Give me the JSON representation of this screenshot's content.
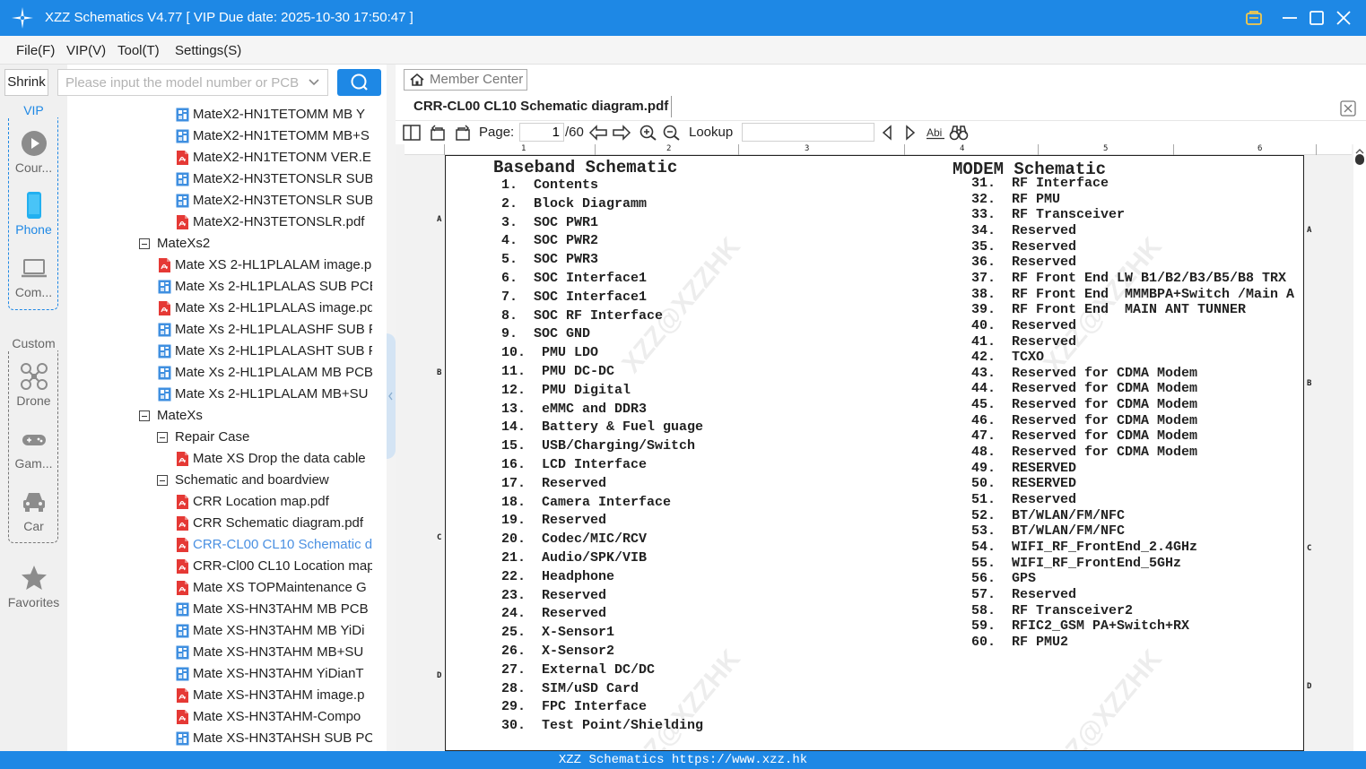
{
  "app": {
    "title": "XZZ Schematics V4.77 [ VIP Due date: 2025-10-30 17:50:47 ]",
    "accent_color": "#1e88e5"
  },
  "window_controls": [
    "vip-badge-icon",
    "minimize-icon",
    "maximize-icon",
    "close-icon"
  ],
  "menu": [
    "File(F)",
    "VIP(V)",
    "Tool(T)",
    "Settings(S)"
  ],
  "sidebar": {
    "shrink_label": "Shrink",
    "vip_label": "VIP",
    "custom_label": "Custom",
    "items": [
      {
        "label": "Cour...",
        "icon": "play-circle-icon",
        "active": false
      },
      {
        "label": "Phone",
        "icon": "phone-icon",
        "active": true
      },
      {
        "label": "Com...",
        "icon": "laptop-icon",
        "active": false
      },
      {
        "label": "Drone",
        "icon": "drone-icon",
        "active": false
      },
      {
        "label": "Gam...",
        "icon": "gamepad-icon",
        "active": false
      },
      {
        "label": "Car",
        "icon": "car-icon",
        "active": false
      },
      {
        "label": "Favorites",
        "icon": "star-icon",
        "active": false
      }
    ]
  },
  "search": {
    "placeholder": "Please input the model number or PCB",
    "value": ""
  },
  "tree": [
    {
      "label": "MateX2-HN1TETOMM MB Y",
      "type": "pcb",
      "depth": 3
    },
    {
      "label": "MateX2-HN1TETOMM MB+S",
      "type": "pcb",
      "depth": 3
    },
    {
      "label": "MateX2-HN1TETONM VER.E",
      "type": "pdf",
      "depth": 3
    },
    {
      "label": "MateX2-HN3TETONSLR SUB",
      "type": "pcb",
      "depth": 3
    },
    {
      "label": "MateX2-HN3TETONSLR SUB",
      "type": "pcb",
      "depth": 3
    },
    {
      "label": "MateX2-HN3TETONSLR.pdf",
      "type": "pdf",
      "depth": 3
    },
    {
      "label": "MateXs2",
      "type": "folder",
      "depth": 1
    },
    {
      "label": "Mate XS 2-HL1PLALAM image.p",
      "type": "pdf",
      "depth": 2
    },
    {
      "label": "Mate Xs 2-HL1PLALAS SUB PCB I",
      "type": "pcb",
      "depth": 2
    },
    {
      "label": "Mate Xs 2-HL1PLALAS image.pdf",
      "type": "pdf",
      "depth": 2
    },
    {
      "label": "Mate Xs 2-HL1PLALASHF SUB PC",
      "type": "pcb",
      "depth": 2
    },
    {
      "label": "Mate Xs 2-HL1PLALASHT SUB PC",
      "type": "pcb",
      "depth": 2
    },
    {
      "label": "Mate Xs 2-HL1PLALAM MB PCB",
      "type": "pcb",
      "depth": 2
    },
    {
      "label": "Mate Xs 2-HL1PLALAM MB+SU",
      "type": "pcb",
      "depth": 2
    },
    {
      "label": "MateXs",
      "type": "folder",
      "depth": 1
    },
    {
      "label": "Repair Case",
      "type": "folder",
      "depth": 2
    },
    {
      "label": "Mate XS Drop the data cable",
      "type": "pdf",
      "depth": 3
    },
    {
      "label": "Schematic and boardview",
      "type": "folder",
      "depth": 2
    },
    {
      "label": "CRR Location map.pdf",
      "type": "pdf",
      "depth": 3
    },
    {
      "label": "CRR Schematic diagram.pdf",
      "type": "pdf",
      "depth": 3
    },
    {
      "label": "CRR-CL00 CL10 Schematic di",
      "type": "pdf",
      "depth": 3,
      "selected": true
    },
    {
      "label": "CRR-Cl00 CL10 Location map",
      "type": "pdf",
      "depth": 3
    },
    {
      "label": "Mate XS TOPMaintenance G",
      "type": "pdf",
      "depth": 3
    },
    {
      "label": "Mate XS-HN3TAHM MB PCB",
      "type": "pcb",
      "depth": 3
    },
    {
      "label": "Mate XS-HN3TAHM MB YiDi",
      "type": "pcb",
      "depth": 3
    },
    {
      "label": "Mate XS-HN3TAHM MB+SU",
      "type": "pcb",
      "depth": 3
    },
    {
      "label": "Mate XS-HN3TAHM YiDianT",
      "type": "pcb",
      "depth": 3
    },
    {
      "label": "Mate XS-HN3TAHM image.p",
      "type": "pdf",
      "depth": 3
    },
    {
      "label": "Mate XS-HN3TAHM-Compo",
      "type": "pdf",
      "depth": 3
    },
    {
      "label": "Mate XS-HN3TAHSH SUB PC",
      "type": "pcb",
      "depth": 3
    }
  ],
  "member_center_label": "Member Center",
  "document": {
    "tab_title": "CRR-CL00 CL10 Schematic diagram.pdf",
    "page_label": "Page:",
    "current_page": "1",
    "total_pages": "/60",
    "lookup_label": "Lookup",
    "lookup_value": ""
  },
  "pdf_page": {
    "ruler_top": [
      "1",
      "2",
      "3",
      "4",
      "5",
      "6"
    ],
    "row_marks": [
      "A",
      "B",
      "C",
      "D"
    ],
    "watermark": "XZZ@XZZHK",
    "left_heading": "Baseband Schematic",
    "right_heading": "MODEM Schematic",
    "left_entries": [
      "1.  Contents",
      "2.  Block Diagramm",
      "3.  SOC PWR1",
      "4.  SOC PWR2",
      "5.  SOC PWR3",
      "6.  SOC Interface1",
      "7.  SOC Interface1",
      "8.  SOC RF Interface",
      "9.  SOC GND",
      "10.  PMU LDO",
      "11.  PMU DC-DC",
      "12.  PMU Digital",
      "13.  eMMC and DDR3",
      "14.  Battery & Fuel guage",
      "15.  USB/Charging/Switch",
      "16.  LCD Interface",
      "17.  Reserved",
      "18.  Camera Interface",
      "19.  Reserved",
      "20.  Codec/MIC/RCV",
      "21.  Audio/SPK/VIB",
      "22.  Headphone",
      "23.  Reserved",
      "24.  Reserved",
      "25.  X-Sensor1",
      "26.  X-Sensor2",
      "27.  External DC/DC",
      "28.  SIM/uSD Card",
      "29.  FPC Interface",
      "30.  Test Point/Shielding"
    ],
    "right_entries": [
      "31.  RF Interface",
      "32.  RF PMU",
      "33.  RF Transceiver",
      "34.  Reserved",
      "35.  Reserved",
      "36.  Reserved",
      "37.  RF Front End LW B1/B2/B3/B5/B8 TRX",
      "38.  RF Front End  MMMBPA+Switch /Main A",
      "39.  RF Front End  MAIN ANT TUNNER",
      "40.  Reserved",
      "41.  Reserved",
      "42.  TCXO",
      "43.  Reserved for CDMA Modem",
      "44.  Reserved for CDMA Modem",
      "45.  Reserved for CDMA Modem",
      "46.  Reserved for CDMA Modem",
      "47.  Reserved for CDMA Modem",
      "48.  Reserved for CDMA Modem",
      "49.  RESERVED",
      "50.  RESERVED",
      "51.  Reserved",
      "52.  BT/WLAN/FM/NFC",
      "53.  BT/WLAN/FM/NFC",
      "54.  WIFI_RF_FrontEnd_2.4GHz",
      "55.  WIFI_RF_FrontEnd_5GHz",
      "56.  GPS",
      "57.  Reserved",
      "58.  RF Transceiver2",
      "59.  RFIC2_GSM PA+Switch+RX",
      "60.  RF PMU2"
    ]
  },
  "footer": "XZZ Schematics https://www.xzz.hk"
}
